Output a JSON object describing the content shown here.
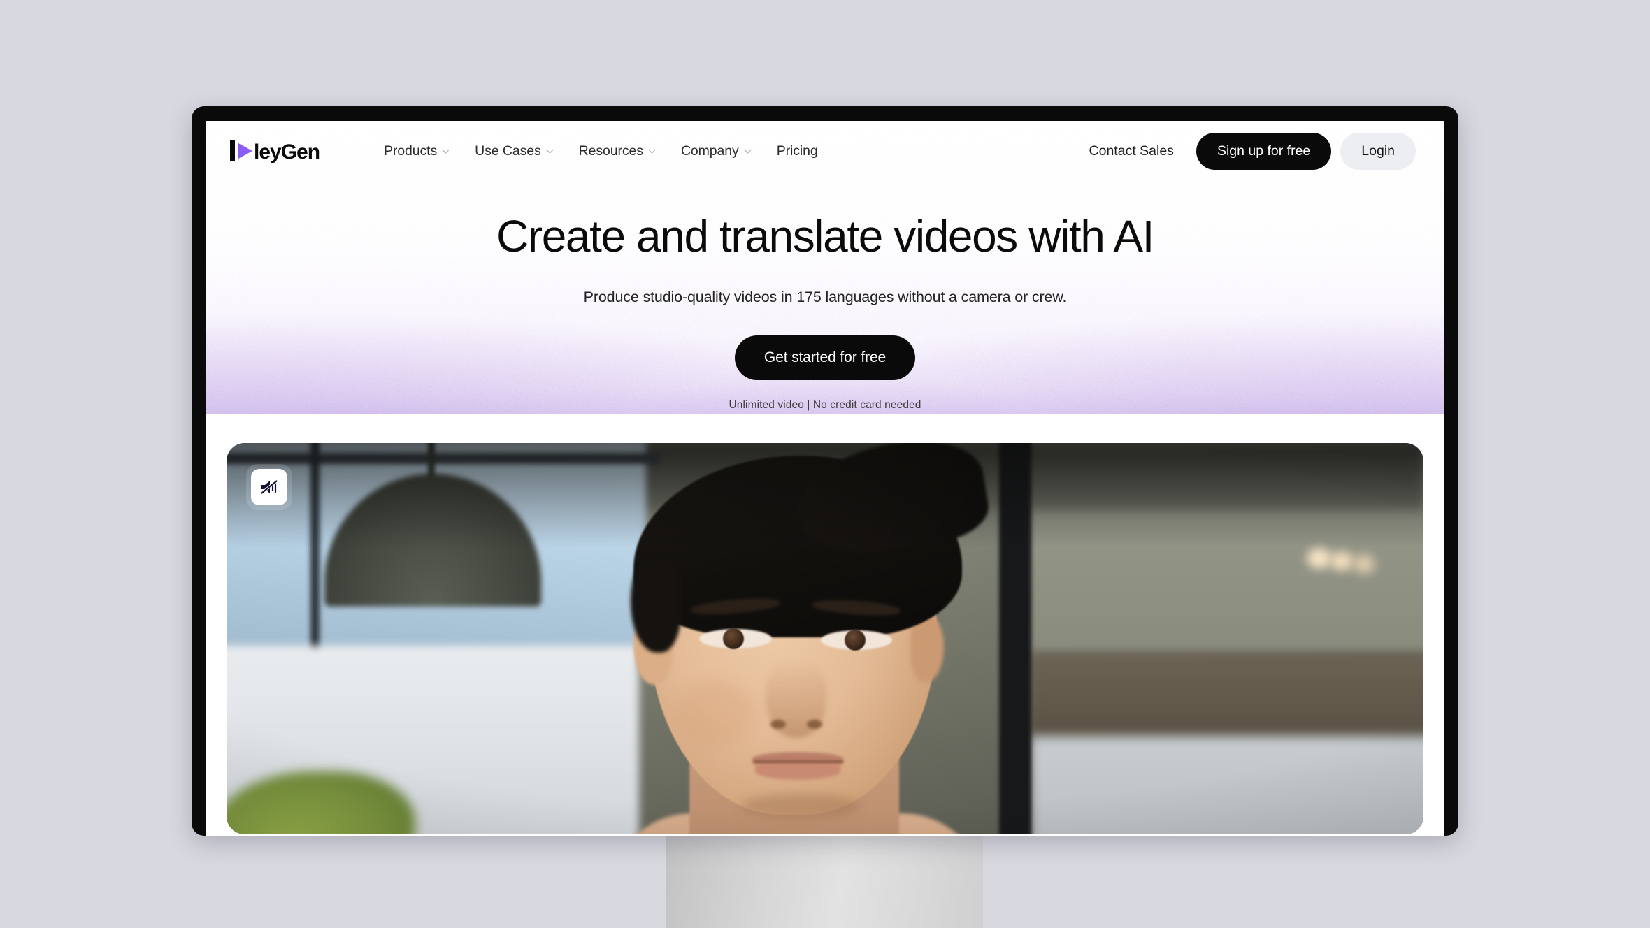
{
  "page": {
    "background_color": "#d8d8e0",
    "device": "desktop-monitor-mockup"
  },
  "brand": {
    "name": "HeyGen",
    "wordmark_text": "leyGen",
    "accent_color": "#8b5cf6",
    "logo_icon": "play-triangle-icon"
  },
  "nav": {
    "links": [
      {
        "label": "Products",
        "has_dropdown": true
      },
      {
        "label": "Use Cases",
        "has_dropdown": true
      },
      {
        "label": "Resources",
        "has_dropdown": true
      },
      {
        "label": "Company",
        "has_dropdown": true
      },
      {
        "label": "Pricing",
        "has_dropdown": false
      }
    ],
    "contact_sales_label": "Contact Sales",
    "signup_label": "Sign up for free",
    "login_label": "Login",
    "signup_bg": "#0a0a0a",
    "login_bg": "#eceef1"
  },
  "hero": {
    "title": "Create and translate videos with AI",
    "subtitle": "Produce studio-quality videos in 175 languages without a camera or crew.",
    "cta_label": "Get started for free",
    "cta_note": "Unlimited video | No credit card needed",
    "wash_color": "#9669d2"
  },
  "video": {
    "mute_icon": "speaker-muted-icon",
    "muted": true,
    "scene_description": "Man in a blurred modern office with large windows"
  }
}
